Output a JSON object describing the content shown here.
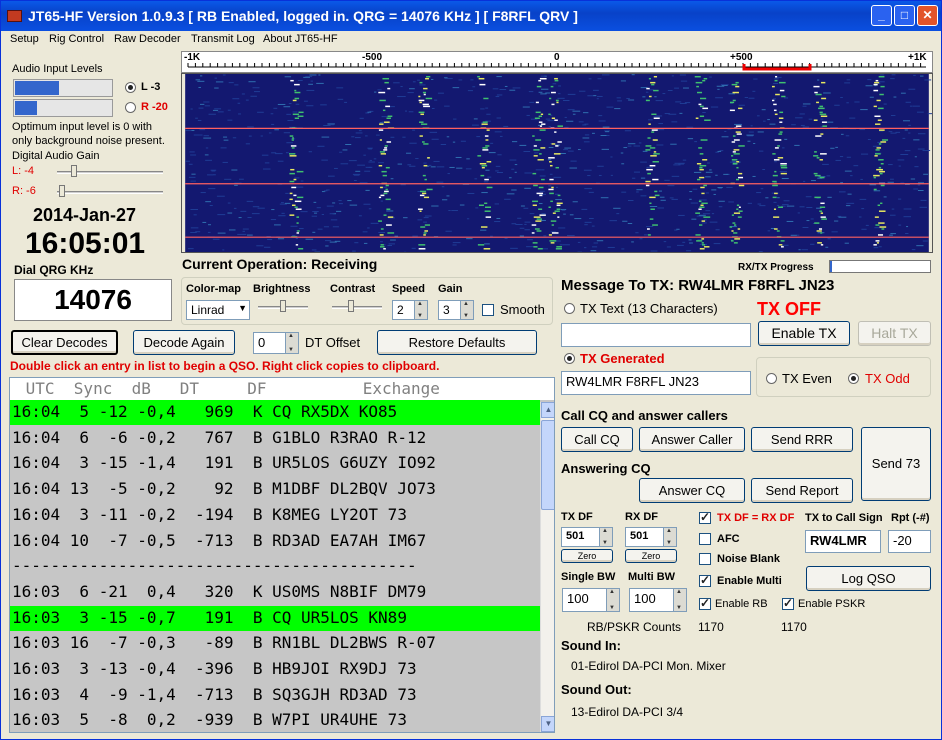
{
  "window": {
    "title": "JT65-HF Version 1.0.9.3  [ RB Enabled, logged in.  QRG = 14076 KHz ]  [ F8RFL QRV ]"
  },
  "menu": [
    "Setup",
    "Rig Control",
    "Raw Decoder",
    "Transmit Log",
    "About JT65-HF"
  ],
  "audio": {
    "heading": "Audio Input Levels",
    "left_label": "L -3",
    "right_label": "R -20",
    "left_level_pct": 45,
    "right_level_pct": 22,
    "selected_channel": "L",
    "note_line1": "Optimum input level is 0 with",
    "note_line2": "only background noise present.",
    "gain_heading": "Digital Audio Gain",
    "gain_left": "L: -4",
    "gain_right": "R: -6"
  },
  "clock": {
    "date": "2014-Jan-27",
    "time": "16:05:01",
    "qrg_label": "Dial QRG KHz",
    "qrg": "14076"
  },
  "scale": {
    "labels": [
      "-1K",
      "-500",
      "0",
      "+500",
      "+1K"
    ]
  },
  "operation": {
    "label": "Current Operation:",
    "value": "Receiving",
    "progress_label": "RX/TX Progress",
    "progress_pct": 2
  },
  "display": {
    "colormap_label": "Color-map",
    "colormap_value": "Linrad",
    "brightness_label": "Brightness",
    "contrast_label": "Contrast",
    "speed_label": "Speed",
    "speed_value": "2",
    "gain_label": "Gain",
    "gain_value": "3",
    "smooth_label": "Smooth",
    "smooth_checked": false
  },
  "controls": {
    "clear_decodes": "Clear Decodes",
    "decode_again": "Decode Again",
    "dt_value": "0",
    "dt_label": "DT Offset",
    "restore_defaults": "Restore Defaults",
    "hint": "Double click an entry in list to begin a QSO.  Right click copies to clipboard."
  },
  "decodes": {
    "header": " UTC  Sync  dB   DT     DF          Exchange",
    "rows": [
      {
        "text": "16:04  5 -12 -0,4   969  K CQ RX5DX KO85",
        "highlight": true
      },
      {
        "text": "16:04  6  -6 -0,2   767  B G1BLO R3RAO R-12",
        "highlight": false
      },
      {
        "text": "16:04  3 -15 -1,4   191  B UR5LOS G6UZY IO92",
        "highlight": false
      },
      {
        "text": "16:04 13  -5 -0,2    92  B M1DBF DL2BQV JO73",
        "highlight": false
      },
      {
        "text": "16:04  3 -11 -0,2  -194  B K8MEG LY2OT 73",
        "highlight": false
      },
      {
        "text": "16:04 10  -7 -0,5  -713  B RD3AD EA7AH IM67",
        "highlight": false
      },
      {
        "text": "------------------------------------------",
        "highlight": false
      },
      {
        "text": "16:03  6 -21  0,4   320  K US0MS N8BIF DM79",
        "highlight": false
      },
      {
        "text": "16:03  3 -15 -0,7   191  B CQ UR5LOS KN89",
        "highlight": true
      },
      {
        "text": "16:03 16  -7 -0,3   -89  B RN1BL DL2BWS R-07",
        "highlight": false
      },
      {
        "text": "16:03  3 -13 -0,4  -396  B HB9JOI RX9DJ 73",
        "highlight": false
      },
      {
        "text": "16:03  4  -9 -1,4  -713  B SQ3GJH RD3AD 73",
        "highlight": false
      },
      {
        "text": "16:03  5  -8  0,2  -939  B W7PI UR4UHE 73",
        "highlight": false
      }
    ]
  },
  "tx": {
    "message_label": "Message To TX: RW4LMR F8RFL JN23",
    "tx_text_label": "TX Text (13 Characters)",
    "tx_status": "TX OFF",
    "tx_text_value": "",
    "enable_tx": "Enable TX",
    "halt_tx": "Halt TX",
    "tx_generated_label": "TX Generated",
    "tx_generated_value": "RW4LMR F8RFL JN23",
    "tx_even": "TX Even",
    "tx_odd": "TX Odd",
    "call_cq_heading": "Call CQ and answer callers",
    "call_cq": "Call CQ",
    "answer_caller": "Answer Caller",
    "send_rrr": "Send RRR",
    "send_73": "Send 73",
    "answering_cq_heading": "Answering CQ",
    "answer_cq": "Answer CQ",
    "send_report": "Send Report"
  },
  "df": {
    "tx_df_label": "TX DF",
    "tx_df_value": "501",
    "rx_df_label": "RX DF",
    "rx_df_value": "501",
    "zero": "Zero",
    "tx_eq_rx": "TX DF = RX DF",
    "afc": "AFC",
    "noise_blank": "Noise Blank",
    "enable_multi": "Enable Multi",
    "single_bw_label": "Single BW",
    "single_bw_value": "100",
    "multi_bw_label": "Multi BW",
    "multi_bw_value": "100",
    "enable_rb": "Enable RB",
    "enable_pskr": "Enable PSKR",
    "tx_to_call_label": "TX to Call Sign",
    "tx_to_call_value": "RW4LMR",
    "rpt_label": "Rpt (-#)",
    "rpt_value": "-20",
    "log_qso": "Log QSO"
  },
  "counts": {
    "label": "RB/PSKR Counts",
    "rb": "1170",
    "pskr": "1170"
  },
  "sound": {
    "in_label": "Sound In:",
    "in_value": "01-Edirol DA-PCI Mon. Mixer",
    "out_label": "Sound Out:",
    "out_value": "13-Edirol DA-PCI 3/4"
  }
}
